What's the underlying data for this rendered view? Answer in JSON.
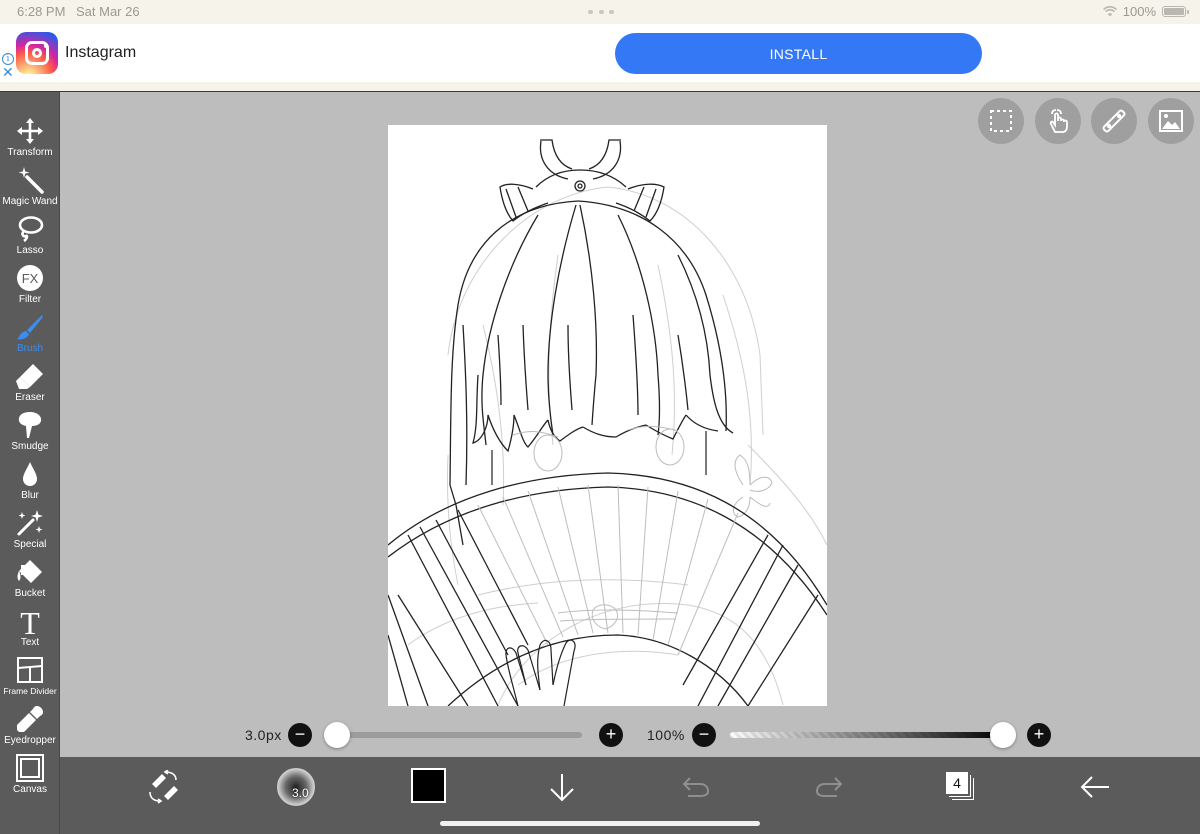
{
  "status_bar": {
    "time": "6:28 PM",
    "date": "Sat Mar 26",
    "battery": "100%"
  },
  "ad": {
    "app_name": "Instagram",
    "install_label": "INSTALL",
    "info_icon": "info-icon",
    "close_icon": "close-icon"
  },
  "toolbar": {
    "items": [
      {
        "label": "Transform",
        "icon": "move-arrows-icon"
      },
      {
        "label": "Magic Wand",
        "icon": "magic-wand-icon"
      },
      {
        "label": "Lasso",
        "icon": "lasso-icon"
      },
      {
        "label": "Filter",
        "icon": "fx-icon"
      },
      {
        "label": "Brush",
        "icon": "brush-icon",
        "active": true
      },
      {
        "label": "Eraser",
        "icon": "eraser-icon"
      },
      {
        "label": "Smudge",
        "icon": "smudge-icon"
      },
      {
        "label": "Blur",
        "icon": "droplet-icon"
      },
      {
        "label": "Special",
        "icon": "sparkle-icon"
      },
      {
        "label": "Bucket",
        "icon": "bucket-icon"
      },
      {
        "label": "Text",
        "icon": "text-icon"
      },
      {
        "label": "Frame Divider",
        "icon": "frame-divider-icon"
      },
      {
        "label": "Eyedropper",
        "icon": "eyedropper-icon"
      },
      {
        "label": "Canvas",
        "icon": "canvas-icon"
      }
    ],
    "active_color": "#3c8df0"
  },
  "top_buttons": [
    {
      "name": "selection-button",
      "icon": "selection-icon"
    },
    {
      "name": "touch-gesture-button",
      "icon": "hand-tap-icon"
    },
    {
      "name": "ruler-button",
      "icon": "ruler-icon"
    },
    {
      "name": "material-button",
      "icon": "image-icon"
    }
  ],
  "brush_size": {
    "value_label": "3.0px",
    "minus": "−",
    "plus": "+",
    "fraction": 0.0
  },
  "opacity": {
    "value_label": "100%",
    "minus": "−",
    "plus": "+",
    "fraction": 1.0
  },
  "bottom_bar": {
    "brush_preview_label": "3.0",
    "color": "#000000",
    "layer_count": "4"
  }
}
